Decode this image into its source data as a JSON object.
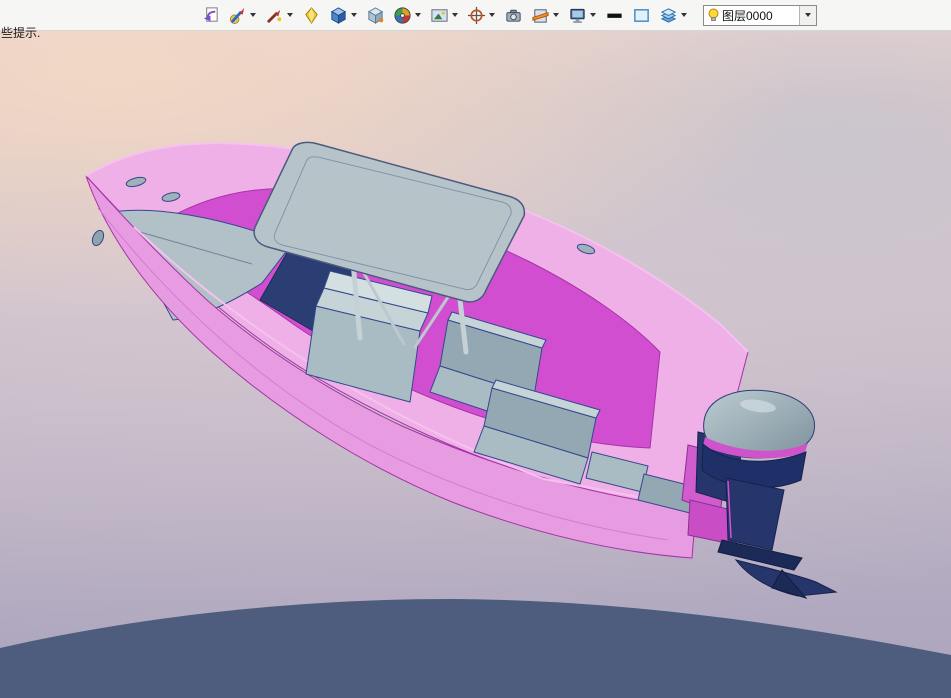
{
  "toolbar": {
    "buttons": [
      {
        "name": "document-arrow",
        "icon": "document-arrow-icon",
        "dropdown": false
      },
      {
        "name": "edit-appearance",
        "icon": "paintbrush-icon",
        "dropdown": true
      },
      {
        "name": "texture-brush",
        "icon": "red-brush-icon",
        "dropdown": true
      },
      {
        "name": "material",
        "icon": "yellow-gem-icon",
        "dropdown": false
      },
      {
        "name": "view-orientation",
        "icon": "blue-cube-icon",
        "dropdown": true
      },
      {
        "name": "isometric-view",
        "icon": "gray-cube-icon",
        "dropdown": false
      },
      {
        "name": "apply-scene",
        "icon": "color-wheel-icon",
        "dropdown": true
      },
      {
        "name": "scene-background",
        "icon": "scene-icon",
        "dropdown": true
      },
      {
        "name": "view-settings",
        "icon": "crosshair-icon",
        "dropdown": true
      },
      {
        "name": "camera",
        "icon": "camera-icon",
        "dropdown": false
      },
      {
        "name": "section-view",
        "icon": "section-plane-icon",
        "dropdown": true
      },
      {
        "name": "display-style",
        "icon": "monitor-icon",
        "dropdown": true
      },
      {
        "name": "edge-color",
        "icon": "black-swatch-icon",
        "dropdown": false
      },
      {
        "name": "viewport-frame",
        "icon": "blue-frame-icon",
        "dropdown": false
      },
      {
        "name": "layer-properties",
        "icon": "layers-icon",
        "dropdown": true
      }
    ],
    "layer_combo": {
      "value": "图层0000",
      "icon": "lightbulb-icon"
    }
  },
  "viewport": {
    "hint_text": "些提示.",
    "model": "3d-boat-with-outboard-motor"
  },
  "colors": {
    "toolbar_bg": "#f6f6f4",
    "combo_border": "#8a8a8a",
    "sky_top": "#e8d2cf",
    "sky_mid": "#cfc3cc",
    "sky_low": "#b2aac0",
    "hill": "#4e5d7e",
    "hull_pink": "#efafe7",
    "hull_side_pink": "#e79ce2",
    "hull_edge": "#a333a6",
    "cockpit_magenta": "#d14ed1",
    "deck_gray": "#b2c1c8",
    "canopy_gray": "#b6c4ca",
    "seat_gray": "#a9bcc4",
    "seat_dark": "#93a8b2",
    "motor_navy": "#26356c",
    "motor_cowl": "#9fb3bc",
    "accent_magenta": "#d05ccd",
    "edge_blue": "#33488c"
  }
}
